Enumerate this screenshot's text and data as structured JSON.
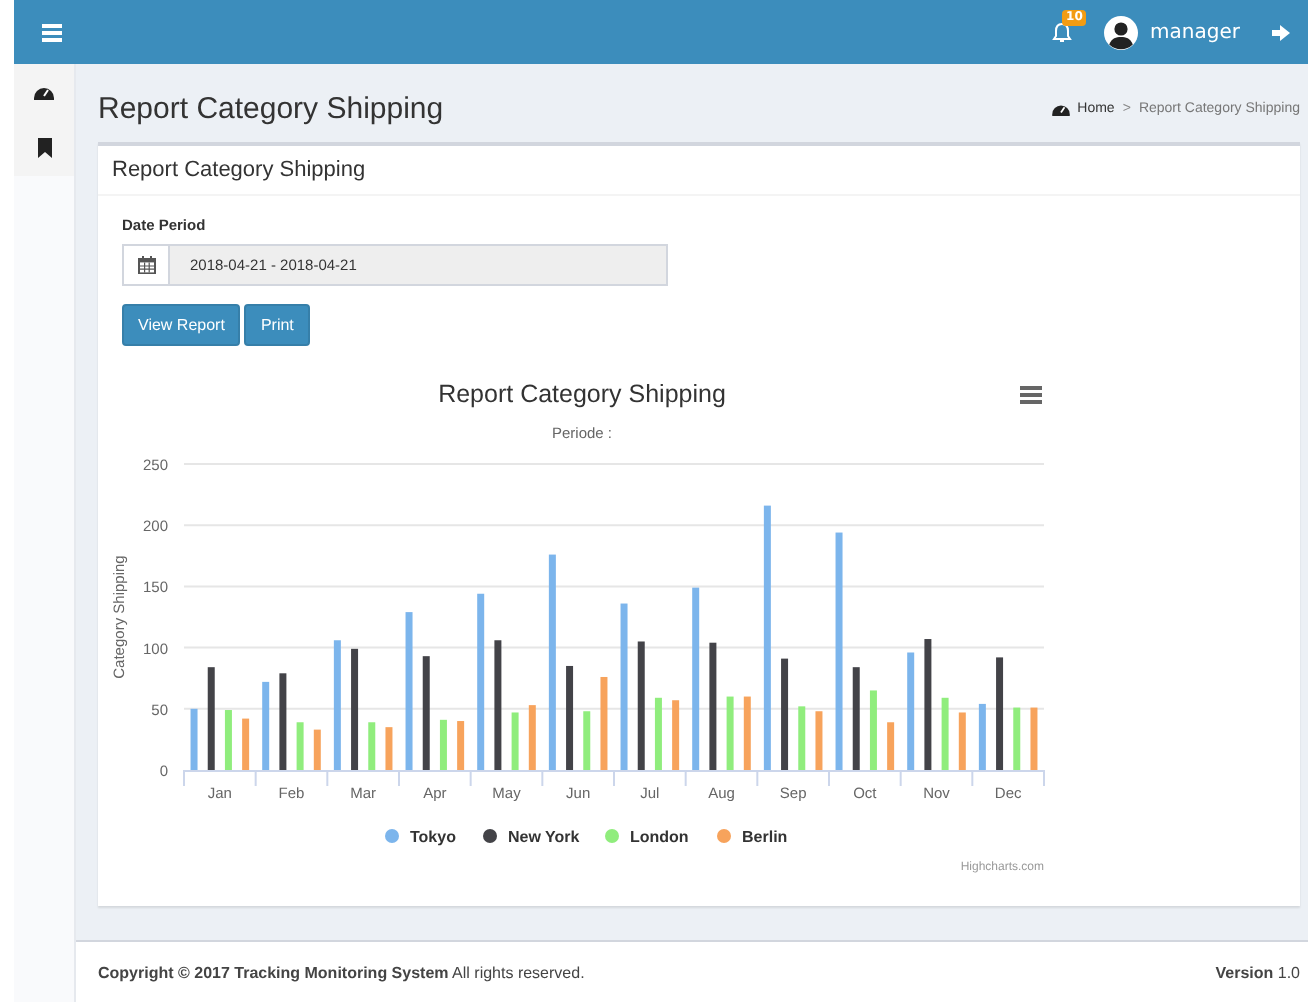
{
  "header": {
    "notification_count": "10",
    "user": "manager"
  },
  "page": {
    "title": "Report Category Shipping",
    "breadcrumb": {
      "home": "Home",
      "separator": ">",
      "current": "Report Category Shipping"
    }
  },
  "box": {
    "title": "Report Category Shipping",
    "date_label": "Date Period",
    "date_value": "2018-04-21 - 2018-04-21",
    "buttons": [
      "View Report",
      "Print"
    ]
  },
  "chart_data": {
    "type": "bar",
    "orientation": "vertical",
    "title": "Report Category Shipping",
    "subtitle": "Periode :",
    "ylabel": "Category Shipping",
    "categories": [
      "Jan",
      "Feb",
      "Mar",
      "Apr",
      "May",
      "Jun",
      "Jul",
      "Aug",
      "Sep",
      "Oct",
      "Nov",
      "Dec"
    ],
    "ylim": [
      0,
      250
    ],
    "yticks": [
      0,
      50,
      100,
      150,
      200,
      250
    ],
    "grid": true,
    "legend": true,
    "series": [
      {
        "name": "Tokyo",
        "color": "#7cb5ec",
        "values": [
          50,
          72,
          106,
          129,
          144,
          176,
          136,
          149,
          216,
          194,
          96,
          54
        ]
      },
      {
        "name": "New York",
        "color": "#434348",
        "values": [
          84,
          79,
          99,
          93,
          106,
          85,
          105,
          104,
          91,
          84,
          107,
          92
        ]
      },
      {
        "name": "London",
        "color": "#90ed7d",
        "values": [
          49,
          39,
          39,
          41,
          47,
          48,
          59,
          60,
          52,
          65,
          59,
          51
        ]
      },
      {
        "name": "Berlin",
        "color": "#f7a35c",
        "values": [
          42,
          33,
          35,
          40,
          53,
          76,
          57,
          60,
          48,
          39,
          47,
          51
        ]
      }
    ]
  },
  "chart_credits": "Highcharts.com",
  "footer": {
    "copyright": "Copyright © 2017 Tracking Monitoring System",
    "rights": "All rights reserved.",
    "version_label": "Version",
    "version": "1.0"
  }
}
